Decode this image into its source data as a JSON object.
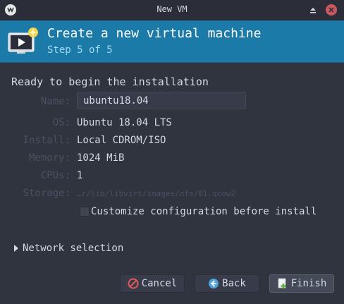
{
  "window": {
    "title": "New VM",
    "buttons": {
      "maximize": "maximize-icon",
      "close": "close-icon"
    }
  },
  "header": {
    "title": "Create a new virtual machine",
    "step": "Step 5 of 5"
  },
  "summary": {
    "heading": "Ready to begin the installation",
    "rows": [
      {
        "label": "Name:",
        "value": "ubuntu18.04"
      },
      {
        "label": "OS:",
        "value": "Ubuntu 18.04 LTS"
      },
      {
        "label": "Install:",
        "value": "Local CDROM/ISO"
      },
      {
        "label": "Memory:",
        "value": "1024 MiB"
      },
      {
        "label": "CPUs:",
        "value": "1"
      },
      {
        "label": "Storage:",
        "value": "…r/lib/libvirt/images/nfs/01.qcow2"
      }
    ]
  },
  "customize": {
    "label": "Customize configuration before install",
    "checked": false
  },
  "network": {
    "label": "Network selection",
    "expanded": false
  },
  "buttons": {
    "cancel": "Cancel",
    "back": "Back",
    "finish": "Finish"
  },
  "colors": {
    "accent": "#1b7aa8",
    "cancel_icon": "#e05a5a",
    "back_icon": "#4aa3df",
    "finish_icon": "#5fae3e"
  }
}
